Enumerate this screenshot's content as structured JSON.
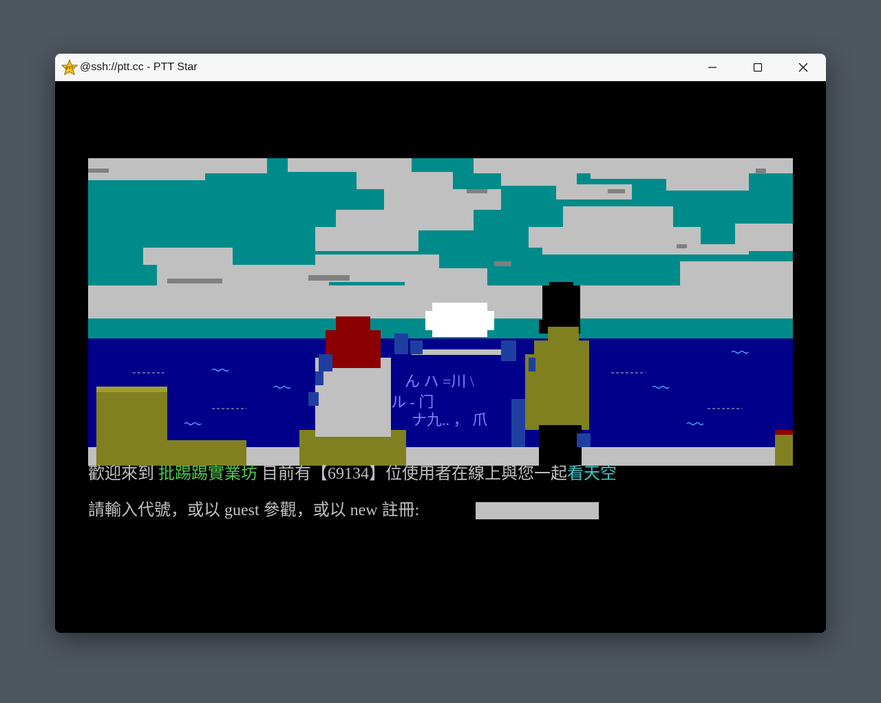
{
  "window": {
    "title": "@ssh://ptt.cc - PTT Star",
    "app_icon": "ptt-star-icon",
    "controls": [
      "minimize-icon",
      "maximize-icon",
      "close-icon"
    ]
  },
  "terminal": {
    "welcome": {
      "prefix": "歡迎來到 ",
      "site_name": "批踢踢實業坊",
      "middle": " 目前有【69134】位使用者在線上與您一起",
      "suffix": "看天空"
    },
    "login": {
      "prompt": "請輸入代號，或以 guest 參觀，或以 new 註冊: ",
      "value": ""
    },
    "art_overlay_text": [
      "ん ハ =川 \\",
      "ル - 门",
      "ナ九.. ， 爪"
    ]
  },
  "colors": {
    "terminal_bg": "#000000",
    "text_default": "#c0c0c0",
    "text_green": "#4cc94c",
    "text_cyan": "#3fc9c9",
    "sky": "#008b8b",
    "cloud": "#c0c0c0",
    "sea": "#00008b",
    "olive": "#808020",
    "red": "#8b0000"
  }
}
